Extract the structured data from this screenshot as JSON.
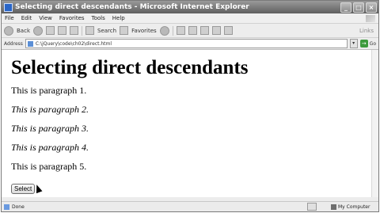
{
  "window": {
    "title": "Selecting direct descendants - Microsoft Internet Explorer",
    "controls": [
      "_",
      "□",
      "×"
    ]
  },
  "menu": [
    "File",
    "Edit",
    "View",
    "Favorites",
    "Tools",
    "Help"
  ],
  "toolbar": {
    "back": "Back",
    "search": "Search",
    "favorites": "Favorites",
    "links": "Links"
  },
  "address": {
    "label": "Address",
    "url": "C:\\jQuery\\code\\ch02\\direct.html",
    "go": "Go"
  },
  "page": {
    "heading": "Selecting direct descendants",
    "paragraphs": [
      "This is paragraph 1.",
      "This is paragraph 2.",
      "This is paragraph 3.",
      "This is paragraph 4.",
      "This is paragraph 5."
    ],
    "button": "Select"
  },
  "status": {
    "left": "Done",
    "zone": "My Computer"
  }
}
